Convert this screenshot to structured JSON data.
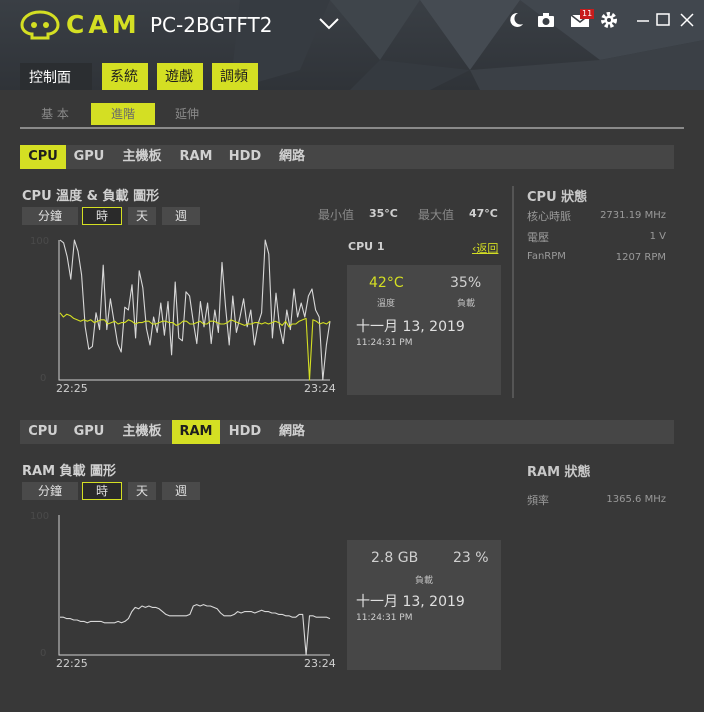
{
  "app": {
    "brand": "CAM",
    "pc_name": "PC-2BGTFT2",
    "mail_count": "11",
    "icons": [
      "cam-logo-icon",
      "chevron-down-icon",
      "moon-icon",
      "camera-icon",
      "mail-icon",
      "gear-icon",
      "minimize-icon",
      "maximize-icon",
      "close-icon"
    ],
    "accent": "#d4df23"
  },
  "nav": {
    "items": [
      "控制面板",
      "系統",
      "遊戲",
      "調頻"
    ]
  },
  "subnav": {
    "items": [
      "基 本",
      "進階",
      "延伸"
    ]
  },
  "tabs": [
    "CPU",
    "GPU",
    "主機板",
    "RAM",
    "HDD",
    "網路"
  ],
  "cpu": {
    "active_tab": "CPU",
    "graph_title": "CPU 溫度 & 負載 圖形",
    "ranges": [
      "分鐘",
      "時",
      "天",
      "週"
    ],
    "selected_range": "時",
    "min_label": "最小值",
    "min_value": "35°C",
    "max_label": "最大值",
    "max_value": "47°C",
    "y_top": "100",
    "y_bottom": "0",
    "x_start": "22:25",
    "x_end": "23:24",
    "card": {
      "title": "CPU 1",
      "back": "‹返回",
      "temp": "42°C",
      "temp_label": "溫度",
      "load": "35%",
      "load_label": "負載",
      "date": "十一月 13, 2019",
      "time": "11:24:31 PM"
    },
    "status": {
      "title": "CPU 狀態",
      "rows": [
        {
          "label": "核心時脈",
          "value": "2731.19 MHz"
        },
        {
          "label": "電壓",
          "value": "1 V"
        },
        {
          "label": "FanRPM",
          "value": "1207 RPM"
        }
      ]
    },
    "load_series": [
      100,
      98,
      88,
      72,
      100,
      92,
      75,
      38,
      22,
      24,
      48,
      36,
      82,
      36,
      58,
      42,
      26,
      20,
      52,
      50,
      68,
      30,
      78,
      66,
      37,
      25,
      45,
      34,
      55,
      32,
      56,
      18,
      70,
      30,
      28,
      63,
      60,
      42,
      26,
      56,
      38,
      55,
      26,
      50,
      34,
      84,
      52,
      25,
      60,
      34,
      45,
      58,
      38,
      50,
      25,
      40,
      48,
      100,
      90,
      30,
      62,
      38,
      26,
      50,
      36,
      65,
      45,
      55,
      45,
      60,
      65,
      50,
      45,
      0,
      25,
      42
    ],
    "temp_series": [
      48,
      45,
      47,
      46,
      44,
      43,
      42,
      43,
      42,
      43,
      41,
      42,
      43,
      43,
      40,
      41,
      42,
      40,
      41,
      41,
      43,
      42,
      40,
      41,
      41,
      42,
      42,
      40,
      40,
      41,
      42,
      42,
      41,
      41,
      39,
      40,
      42,
      42,
      40,
      40,
      41,
      42,
      40,
      40,
      42,
      42,
      41,
      40,
      40,
      41,
      43,
      42,
      41,
      40,
      39,
      40,
      40,
      41,
      41,
      40,
      41,
      40,
      41,
      42,
      41,
      39,
      42,
      38,
      40,
      40,
      42,
      43,
      44,
      0,
      43,
      42,
      40,
      41,
      40,
      42
    ]
  },
  "ram": {
    "active_tab": "RAM",
    "graph_title": "RAM 負載 圖形",
    "ranges": [
      "分鐘",
      "時",
      "天",
      "週"
    ],
    "selected_range": "時",
    "y_top": "100",
    "y_bottom": "0",
    "x_start": "22:25",
    "x_end": "23:24",
    "card": {
      "used": "2.8 GB",
      "load": "23 %",
      "load_label": "負載",
      "date": "十一月 13, 2019",
      "time": "11:24:31 PM"
    },
    "status": {
      "title": "RAM 狀態",
      "rows": [
        {
          "label": "頻率",
          "value": "1365.6 MHz"
        }
      ]
    },
    "load_series": [
      27,
      27,
      26,
      26,
      25,
      25,
      24,
      24,
      23,
      24,
      24,
      24,
      24,
      23,
      23,
      23,
      23,
      24,
      23,
      24,
      26,
      31,
      34,
      33,
      35,
      34,
      35,
      34,
      34,
      33,
      31,
      29,
      28,
      28,
      28,
      28,
      28,
      28,
      29,
      35,
      36,
      35,
      36,
      35,
      35,
      34,
      33,
      30,
      28,
      28,
      28,
      29,
      31,
      30,
      31,
      31,
      31,
      30,
      31,
      32,
      31,
      31,
      30,
      30,
      29,
      29,
      28,
      28,
      27,
      27,
      29,
      29,
      0,
      28,
      28,
      27,
      27,
      27,
      27,
      26
    ]
  }
}
